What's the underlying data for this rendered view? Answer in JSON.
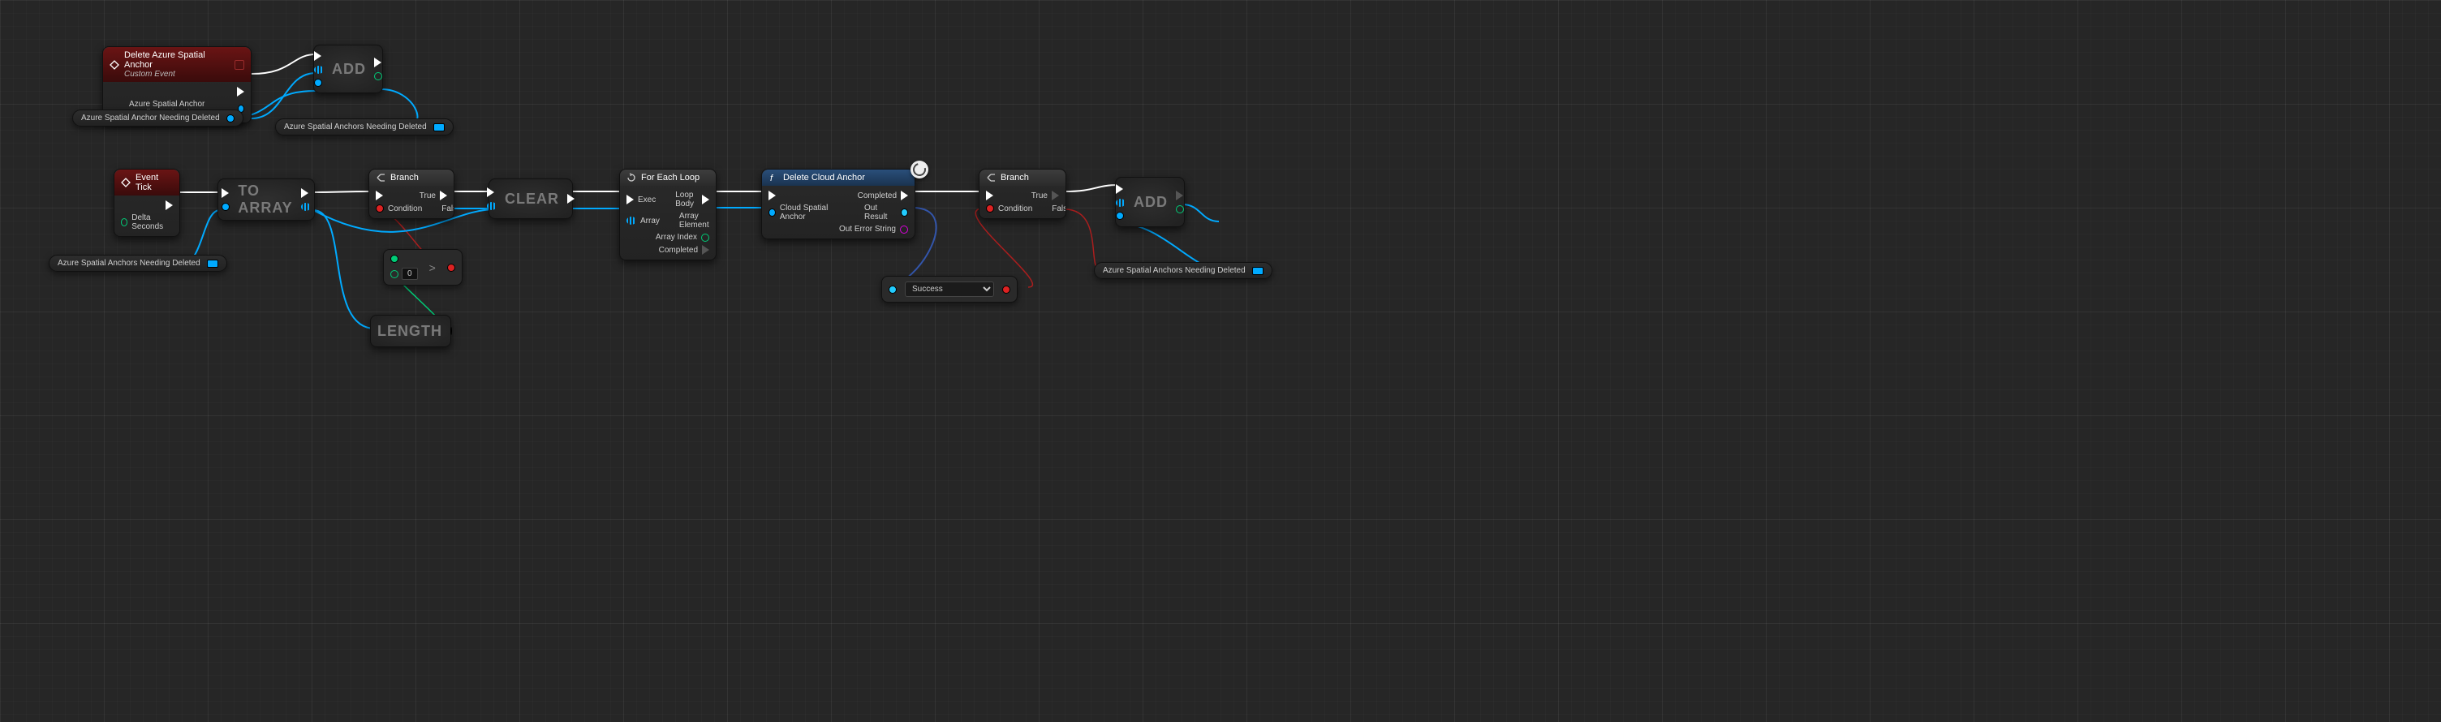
{
  "nodes": {
    "custom_event": {
      "title": "Delete Azure Spatial Anchor",
      "subtitle": "Custom Event",
      "out_param": "Azure Spatial Anchor Needing Deleted"
    },
    "add_top": {
      "title": "ADD"
    },
    "var_top_out": "Azure Spatial Anchors Needing Deleted",
    "event_tick": {
      "title": "Event Tick",
      "out_param": "Delta Seconds"
    },
    "to_array": {
      "title": "TO ARRAY"
    },
    "var_left_in": "Azure Spatial Anchors Needing Deleted",
    "branch1": {
      "title": "Branch",
      "in_cond": "Condition",
      "out_true": "True",
      "out_false": "False"
    },
    "clear": {
      "title": "CLEAR"
    },
    "greater": {
      "literal": "0"
    },
    "length": {
      "title": "LENGTH"
    },
    "foreach": {
      "title": "For Each Loop",
      "in_exec": "Exec",
      "in_array": "Array",
      "out_body": "Loop Body",
      "out_elem": "Array Element",
      "out_idx": "Array Index",
      "out_done": "Completed"
    },
    "delete_cloud": {
      "title": "Delete Cloud Anchor",
      "in_anchor": "Cloud Spatial Anchor",
      "out_completed": "Completed",
      "out_result": "Out Result",
      "out_error": "Out Error String"
    },
    "branch2": {
      "title": "Branch",
      "in_cond": "Condition",
      "out_true": "True",
      "out_false": "False"
    },
    "select": {
      "value": "Success"
    },
    "add_right": {
      "title": "ADD"
    },
    "var_right_out": "Azure Spatial Anchors Needing Deleted"
  }
}
